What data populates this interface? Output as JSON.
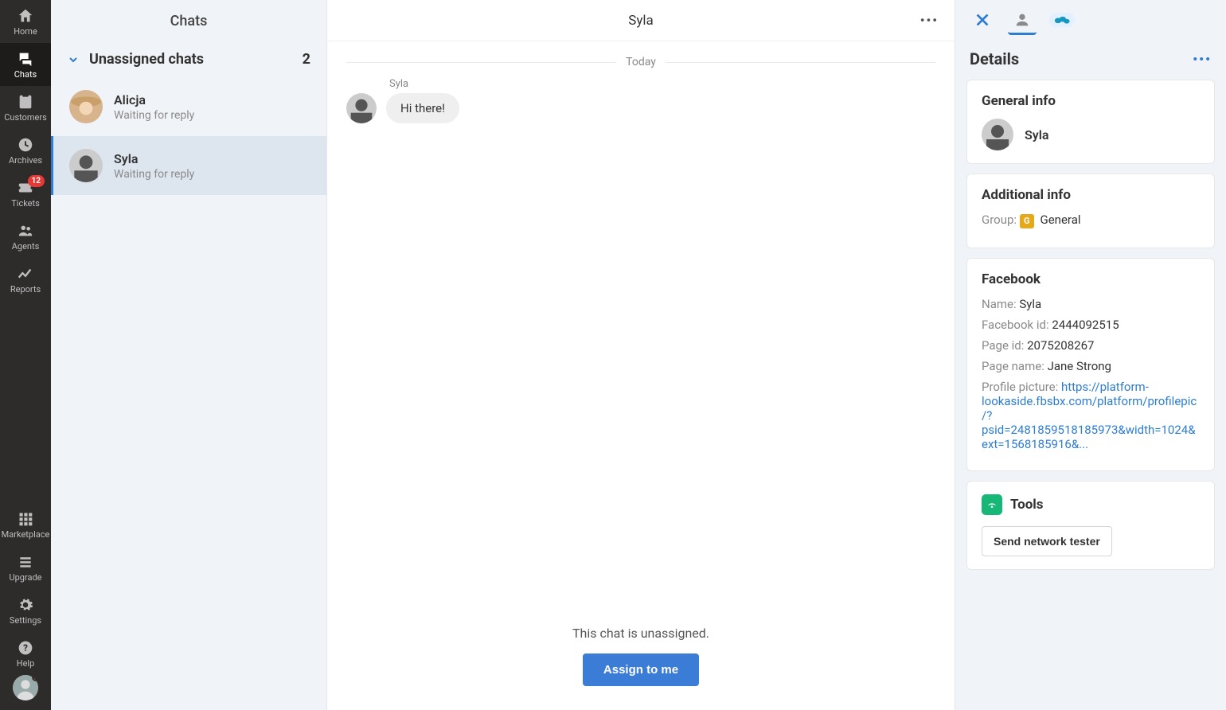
{
  "nav": {
    "items": [
      {
        "label": "Home"
      },
      {
        "label": "Chats"
      },
      {
        "label": "Customers"
      },
      {
        "label": "Archives"
      },
      {
        "label": "Tickets",
        "badge": "12"
      },
      {
        "label": "Agents"
      },
      {
        "label": "Reports"
      }
    ],
    "bottom": [
      {
        "label": "Marketplace"
      },
      {
        "label": "Upgrade"
      },
      {
        "label": "Settings"
      },
      {
        "label": "Help"
      }
    ]
  },
  "chat_list": {
    "title": "Chats",
    "group_label": "Unassigned chats",
    "group_count": "2",
    "items": [
      {
        "name": "Alicja",
        "status": "Waiting for reply"
      },
      {
        "name": "Syla",
        "status": "Waiting for reply"
      }
    ]
  },
  "conversation": {
    "title": "Syla",
    "date_label": "Today",
    "sender": "Syla",
    "message": "Hi there!",
    "unassigned_text": "This chat is unassigned.",
    "assign_label": "Assign to me"
  },
  "details": {
    "title": "Details",
    "general": {
      "heading": "General info",
      "name": "Syla"
    },
    "additional": {
      "heading": "Additional info",
      "group_label": "Group:",
      "group_value": "General",
      "group_badge": "G"
    },
    "facebook": {
      "heading": "Facebook",
      "name_label": "Name:",
      "name_value": "Syla",
      "fbid_label": "Facebook id:",
      "fbid_value": "2444092515",
      "pageid_label": "Page id:",
      "pageid_value": "2075208267",
      "pagename_label": "Page name:",
      "pagename_value": "Jane Strong",
      "pic_label": "Profile picture:",
      "pic_url": "https://platform-lookaside.fbsbx.com/platform/profilepic/?psid=2481859518185973&width=1024&ext=1568185916&..."
    },
    "tools": {
      "heading": "Tools",
      "button": "Send network tester"
    }
  }
}
